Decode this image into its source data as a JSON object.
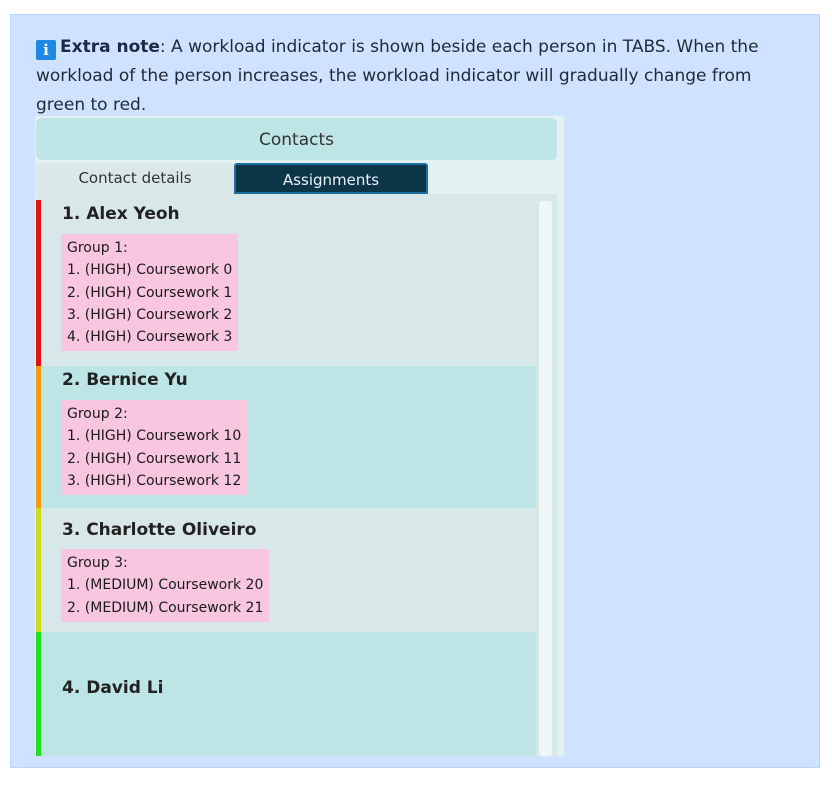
{
  "note": {
    "label": "Extra note",
    "text": ": A workload indicator is shown beside each person in TABS. When the workload of the person increases, the workload indicator will gradually change from green to red.",
    "icon": "info-icon"
  },
  "app": {
    "title": "Contacts",
    "tabs": [
      {
        "label": "Contact details",
        "selected": false
      },
      {
        "label": "Assignments",
        "selected": true
      }
    ],
    "persons": [
      {
        "name": "1.  Alex Yeoh",
        "indicator_color": "#e31010",
        "group": {
          "title": "Group 1:",
          "items": [
            "1. (HIGH) Coursework 0",
            "2. (HIGH) Coursework 1",
            "3. (HIGH) Coursework 2",
            "4. (HIGH) Coursework 3"
          ]
        }
      },
      {
        "name": "2.  Bernice Yu",
        "indicator_color": "#f29b12",
        "group": {
          "title": "Group 2:",
          "items": [
            "1. (HIGH) Coursework 10",
            "2. (HIGH) Coursework 11",
            "3. (HIGH) Coursework 12"
          ]
        }
      },
      {
        "name": "3.  Charlotte Oliveiro",
        "indicator_color": "#c9dd1a",
        "group": {
          "title": "Group 3:",
          "items": [
            "1. (MEDIUM) Coursework 20",
            "2. (MEDIUM) Coursework 21"
          ]
        }
      },
      {
        "name": "4.  David Li",
        "indicator_color": "#1ee01e",
        "group": null
      }
    ]
  }
}
